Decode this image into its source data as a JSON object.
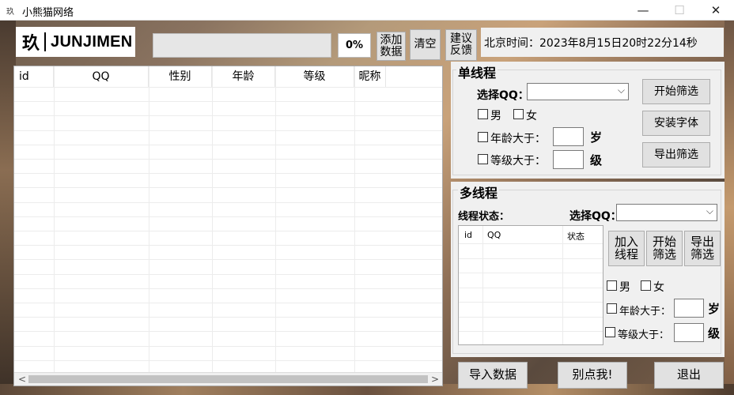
{
  "window": {
    "title": "小熊猫网络",
    "app_icon_text": "玖",
    "minimize": "—",
    "maximize": "☐",
    "close": "✕"
  },
  "logo": {
    "glyph": "玖",
    "brand": "JUNJIMEN"
  },
  "progress": {
    "percent_label": "0%",
    "value": 0
  },
  "toolbar": {
    "add_data_line1": "添加",
    "add_data_line2": "数据",
    "clear": "清空",
    "feedback_line1": "建议",
    "feedback_line2": "反馈"
  },
  "clock": {
    "text": "北京时间：2023年8月15日20时22分14秒"
  },
  "main_table": {
    "columns": [
      "id",
      "QQ",
      "性别",
      "年龄",
      "等级",
      "昵称"
    ],
    "rows": []
  },
  "single_thread": {
    "title": "单线程",
    "select_qq_label": "选择QQ：",
    "select_qq_value": "",
    "male": "男",
    "female": "女",
    "age_label": "年龄大于：",
    "age_value": "",
    "age_unit": "岁",
    "level_label": "等级大于：",
    "level_value": "",
    "level_unit": "级",
    "start_filter": "开始筛选",
    "install_font": "安装字体",
    "export_filter": "导出筛选"
  },
  "multi_thread": {
    "title": "多线程",
    "status_label": "线程状态：",
    "select_qq_label": "选择QQ：",
    "select_qq_value": "",
    "columns": [
      "id",
      "QQ",
      "状态"
    ],
    "add_thread_line1": "加入",
    "add_thread_line2": "线程",
    "start_line1": "开始",
    "start_line2": "筛选",
    "export_line1": "导出",
    "export_line2": "筛选",
    "male": "男",
    "female": "女",
    "age_label": "年龄大于：",
    "age_value": "",
    "age_unit": "岁",
    "level_label": "等级大于：",
    "level_value": "",
    "level_unit": "级"
  },
  "footer": {
    "import": "导入数据",
    "dont_click": "别点我!",
    "exit": "退出"
  },
  "scroll": {
    "left": "<",
    "right": ">"
  },
  "colors": {
    "panel_bg": "#f0f0f0",
    "button_bg": "#e1e1e1",
    "button_border": "#adadad"
  }
}
